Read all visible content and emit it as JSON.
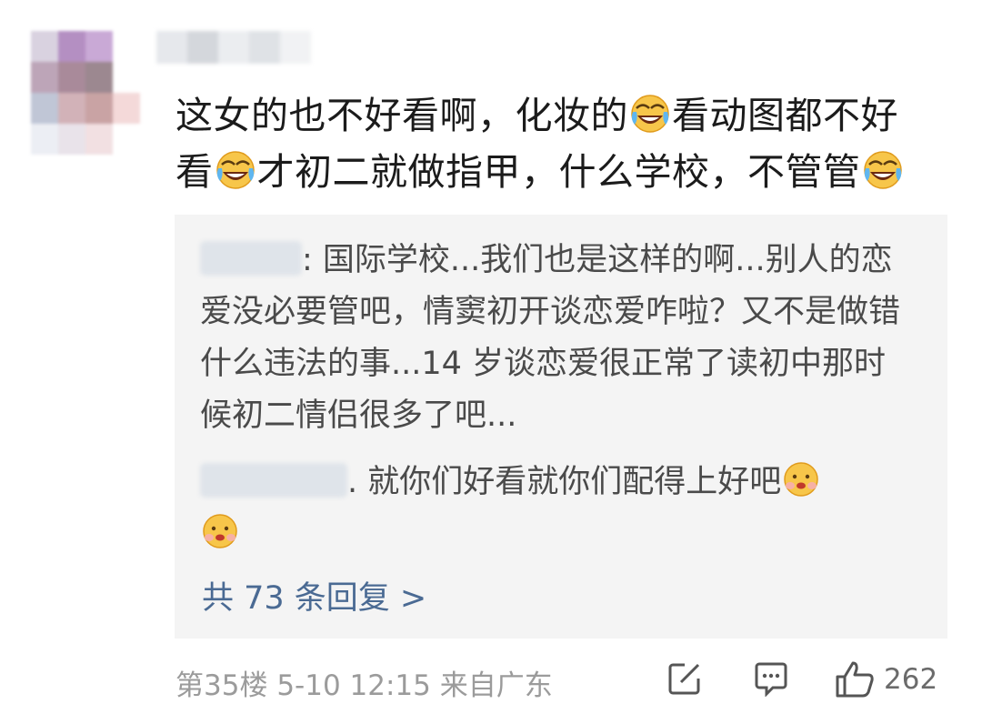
{
  "comment": {
    "text_line1_a": "这女的也不好看啊，化妆的",
    "text_line1_b": "看动图都不好",
    "text_line2_a": "看",
    "text_line2_b": "才初二就做指甲，什么学校，不管管",
    "emoji": "laughing-crying-emoji"
  },
  "replies": [
    {
      "separator": ":",
      "text": " 国际学校...我们也是这样的啊...别人的恋爱没必要管吧，情窦初开谈恋爱咋啦？又不是做错什么违法的事...14 岁谈恋爱很正常了读初中那时候初二情侣很多了吧..."
    },
    {
      "separator": ".",
      "text": " 就你们好看就你们配得上好吧",
      "emoji": "shy-blush-emoji"
    }
  ],
  "more_replies_label": "共 73 条回复 >",
  "footer": {
    "floor": "第35楼",
    "date": "5-10",
    "time": "12:15",
    "location": "来自广东",
    "like_count": "262"
  },
  "colors": {
    "text": "#1b1b1b",
    "reply_text": "#4a4a4a",
    "link": "#4a6a93",
    "meta": "#9b9b9b",
    "reply_bg": "#f4f4f4"
  }
}
